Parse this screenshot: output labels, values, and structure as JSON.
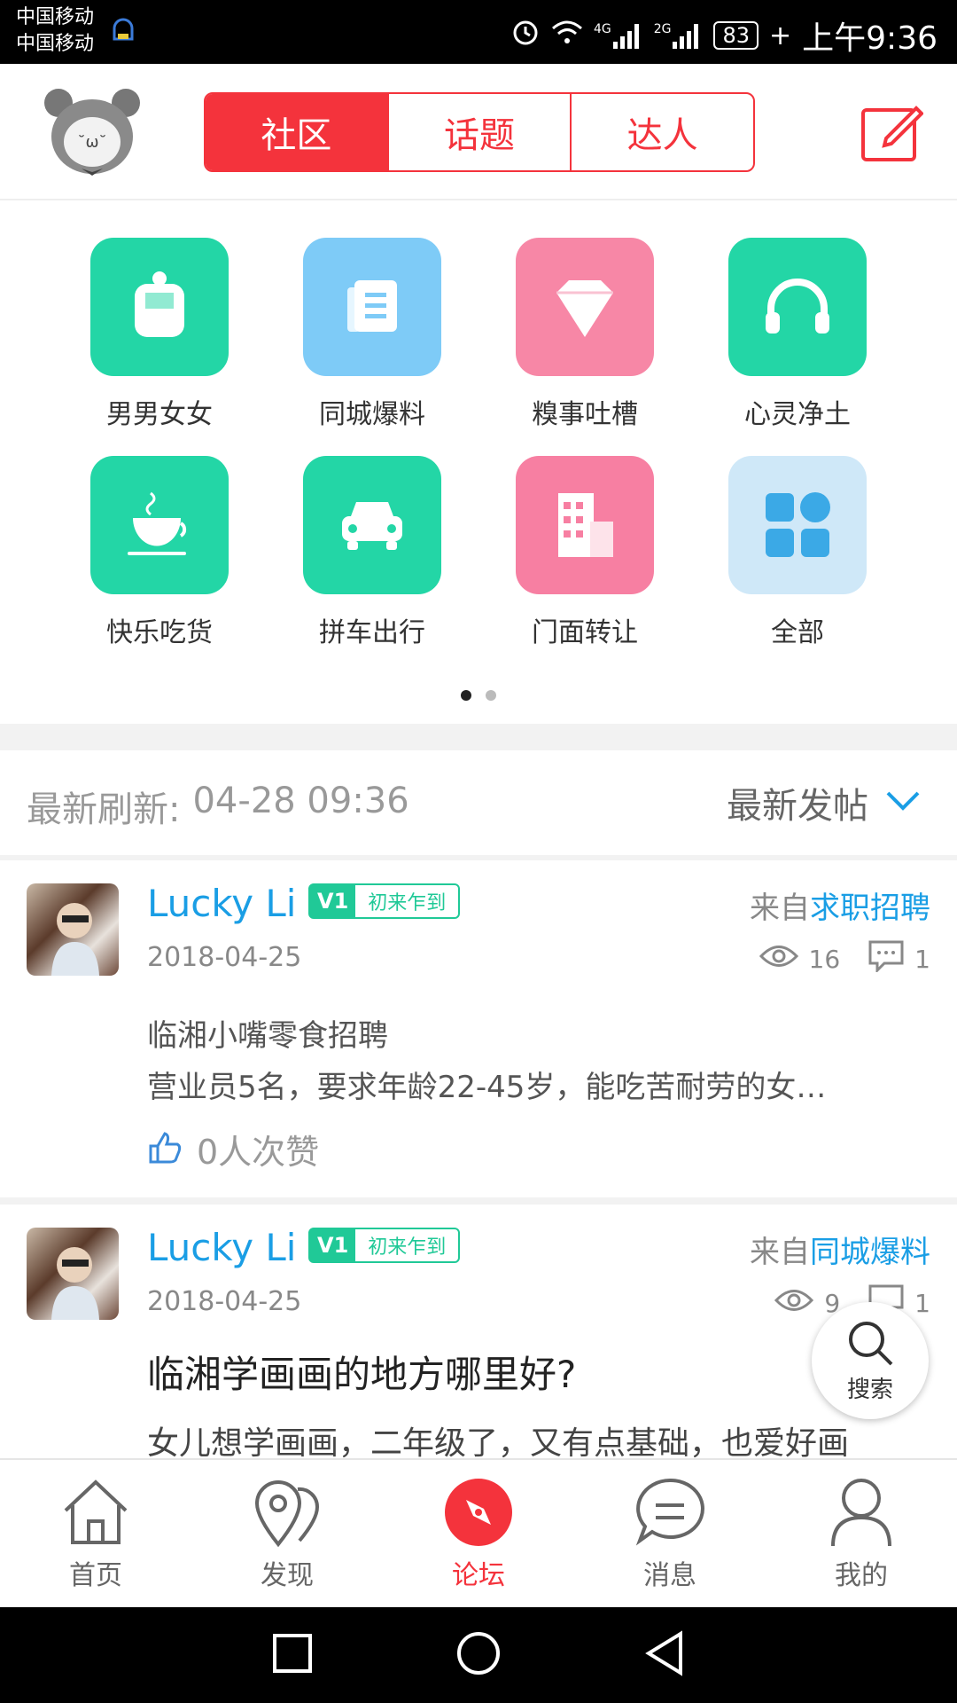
{
  "status_bar": {
    "carrier1": "中国移动",
    "carrier2": "中国移动",
    "battery": "83",
    "time": "上午9:36",
    "net1": "4G",
    "net2": "2G"
  },
  "header": {
    "tabs": [
      {
        "label": "社区",
        "active": true
      },
      {
        "label": "话题",
        "active": false
      },
      {
        "label": "达人",
        "active": false
      }
    ]
  },
  "categories": [
    {
      "label": "男男女女",
      "icon": "couple-icon",
      "color": "#23d6a6"
    },
    {
      "label": "同城爆料",
      "icon": "news-icon",
      "color": "#7ecbf7"
    },
    {
      "label": "糗事吐槽",
      "icon": "diamond-icon",
      "color": "#f787a6"
    },
    {
      "label": "心灵净土",
      "icon": "headphones-icon",
      "color": "#23d6a6"
    },
    {
      "label": "快乐吃货",
      "icon": "coffee-icon",
      "color": "#23d6a6"
    },
    {
      "label": "拼车出行",
      "icon": "car-icon",
      "color": "#23d6a6"
    },
    {
      "label": "门面转让",
      "icon": "building-icon",
      "color": "#f77fa2"
    },
    {
      "label": "全部",
      "icon": "grid-icon",
      "color": "#cfe8f8"
    }
  ],
  "refresh": {
    "label": "最新刷新:",
    "time": "04-28 09:36",
    "sort_label": "最新发帖"
  },
  "posts": [
    {
      "user": "Lucky Li",
      "level": "V1",
      "badge": "初来乍到",
      "from_prefix": "来自",
      "from_board": "求职招聘",
      "date": "2018-04-25",
      "views": "16",
      "comments": "1",
      "title": "临湘小嘴零食招聘",
      "excerpt": "营业员5名，要求年龄22-45岁，能吃苦耐劳的女…",
      "likes": "0人次赞"
    },
    {
      "user": "Lucky Li",
      "level": "V1",
      "badge": "初来乍到",
      "from_prefix": "来自",
      "from_board": "同城爆料",
      "date": "2018-04-25",
      "views": "9",
      "comments": "1",
      "title": "临湘学画画的地方哪里好?",
      "excerpt": "女儿想学画画，二年级了，又有点基础，也爱好画"
    }
  ],
  "search_fab": {
    "label": "搜索"
  },
  "bottom_nav": [
    {
      "label": "首页",
      "icon": "home-icon",
      "active": false
    },
    {
      "label": "发现",
      "icon": "location-icon",
      "active": false
    },
    {
      "label": "论坛",
      "icon": "compass-icon",
      "active": true
    },
    {
      "label": "消息",
      "icon": "message-icon",
      "active": false
    },
    {
      "label": "我的",
      "icon": "user-icon",
      "active": false
    }
  ],
  "colors": {
    "accent": "#f4333c",
    "link": "#1a9ee5",
    "level": "#20c997"
  }
}
